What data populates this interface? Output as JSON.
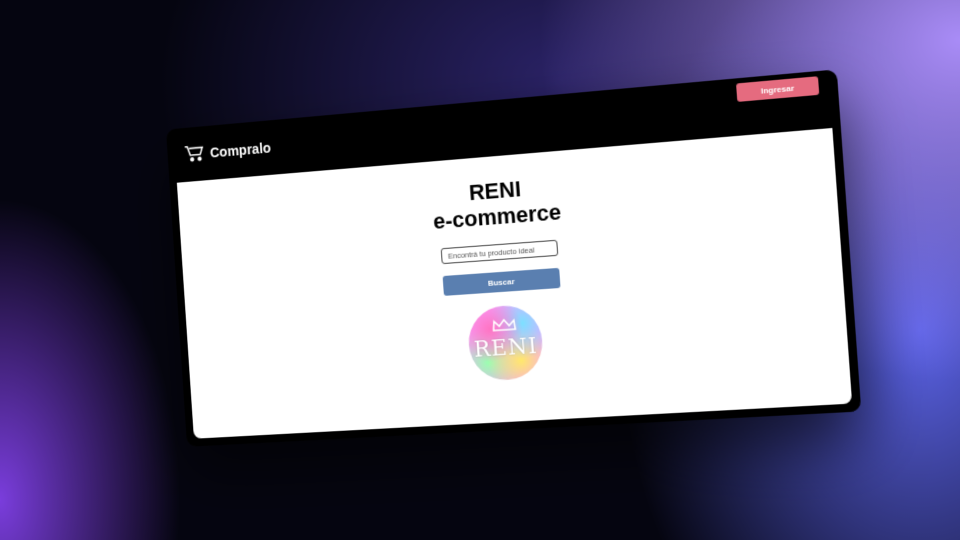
{
  "navbar": {
    "brand_name": "Compralo",
    "brand_icon": "cart-icon",
    "login_label": "Ingresar"
  },
  "main": {
    "title_line1": "RENI",
    "title_line2": "e-commerce",
    "search_placeholder": "Encontrá tu producto ideal",
    "search_button_label": "Buscar",
    "logo_text": "RENI",
    "logo_icon": "crown-icon"
  },
  "colors": {
    "login_button": "#e56b7f",
    "search_button": "#5a7fb0",
    "navbar": "#000000",
    "content": "#ffffff"
  }
}
